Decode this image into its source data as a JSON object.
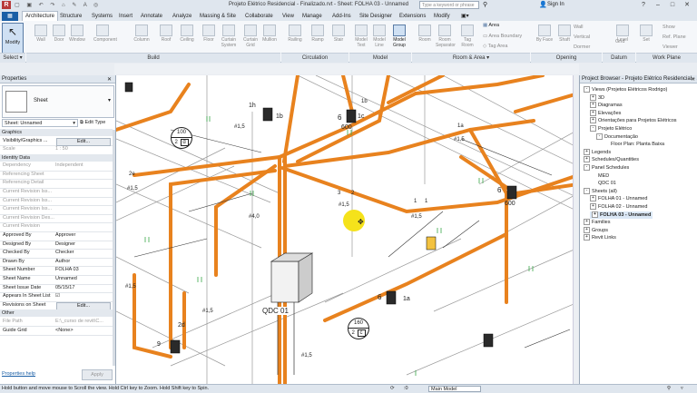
{
  "window": {
    "title": "Projeto Elétrico Residencial - Finalizado.rvt - Sheet: FOLHA 03 - Unnamed",
    "search_placeholder": "Type a keyword or phrase",
    "sign_in": "Sign In"
  },
  "tabs": [
    "Architecture",
    "Structure",
    "Systems",
    "Insert",
    "Annotate",
    "Analyze",
    "Massing & Site",
    "Collaborate",
    "View",
    "Manage",
    "Add-Ins",
    "Site Designer",
    "Extensions",
    "Modify"
  ],
  "ribbon": {
    "buttons": [
      {
        "label": "Modify",
        "on": true
      },
      {
        "label": "Wall",
        "on": false
      },
      {
        "label": "Door",
        "on": false
      },
      {
        "label": "Window",
        "on": false
      },
      {
        "label": "Component",
        "on": false
      },
      {
        "label": "Column",
        "on": false
      },
      {
        "label": "Roof",
        "on": false
      },
      {
        "label": "Ceiling",
        "on": false
      },
      {
        "label": "Floor",
        "on": false
      },
      {
        "label": "Curtain System",
        "on": false
      },
      {
        "label": "Curtain Grid",
        "on": false
      },
      {
        "label": "Mullion",
        "on": false
      },
      {
        "label": "Railing",
        "on": false
      },
      {
        "label": "Ramp",
        "on": false
      },
      {
        "label": "Stair",
        "on": false
      },
      {
        "label": "Model Text",
        "on": false
      },
      {
        "label": "Model Line",
        "on": false
      },
      {
        "label": "Model Group",
        "on": true
      },
      {
        "label": "Room",
        "on": false
      },
      {
        "label": "Room Separator",
        "on": false
      },
      {
        "label": "Tag Room",
        "on": false
      },
      {
        "label": "By Face",
        "on": false
      },
      {
        "label": "Shaft",
        "on": false
      },
      {
        "label": "Level",
        "on": false
      },
      {
        "label": "Set",
        "on": false
      }
    ],
    "side_items": [
      "Area",
      "Area Boundary",
      "Tag Area",
      "Wall",
      "Vertical",
      "Dormer",
      "Grid",
      "Show",
      "Ref. Plane",
      "Viewer"
    ],
    "panels": [
      "Select",
      "Build",
      "Circulation",
      "Model",
      "Room & Area",
      "Opening",
      "Datum",
      "Work Plane"
    ]
  },
  "properties": {
    "header": "Properties",
    "type_name": "Sheet",
    "selector": "Sheet: Unnamed",
    "edit_type": "Edit Type",
    "sections": {
      "graphics": "Graphics",
      "identity": "Identity Data",
      "other": "Other"
    },
    "graphics_rows": [
      {
        "k": "Visibility/Graphics ...",
        "v": "Edit...",
        "button": true
      },
      {
        "k": "Scale",
        "v": "1 : 50",
        "grey": true
      }
    ],
    "identity_rows": [
      {
        "k": "Dependency",
        "v": "Independent",
        "grey": true
      },
      {
        "k": "Referencing Sheet",
        "v": "",
        "grey": true
      },
      {
        "k": "Referencing Detail",
        "v": "",
        "grey": true
      },
      {
        "k": "Current Revision Iss...",
        "v": "",
        "grey": true
      },
      {
        "k": "Current Revision Iss...",
        "v": "",
        "grey": true
      },
      {
        "k": "Current Revision Iss...",
        "v": "",
        "grey": true
      },
      {
        "k": "Current Revision Des...",
        "v": "",
        "grey": true
      },
      {
        "k": "Current Revision",
        "v": "",
        "grey": true
      },
      {
        "k": "Approved By",
        "v": "Approver"
      },
      {
        "k": "Designed By",
        "v": "Designer"
      },
      {
        "k": "Checked By",
        "v": "Checker"
      },
      {
        "k": "Drawn By",
        "v": "Author"
      },
      {
        "k": "Sheet Number",
        "v": "FOLHA 03"
      },
      {
        "k": "Sheet Name",
        "v": "Unnamed"
      },
      {
        "k": "Sheet Issue Date",
        "v": "05/15/17"
      },
      {
        "k": "Appears In Sheet List",
        "v": "☑"
      },
      {
        "k": "Revisions on Sheet",
        "v": "Edit...",
        "button": true
      }
    ],
    "other_rows": [
      {
        "k": "File Path",
        "v": "E:\\_curso de revit\\C...",
        "grey": true
      },
      {
        "k": "Guide Grid",
        "v": "<None>"
      }
    ],
    "help_link": "Properties help",
    "apply": "Apply"
  },
  "canvas": {
    "callouts": [
      {
        "num": "100",
        "sub": "2",
        "letter": "d"
      },
      {
        "num": "160",
        "sub": "2",
        "letter": "c"
      }
    ],
    "panel_label": "QDC 01",
    "labels": [
      "1h",
      "1b",
      "1c",
      "1b",
      "6",
      "600",
      "6",
      "600",
      "2e",
      "1a",
      "2d",
      "3",
      "2",
      "1",
      "1",
      "6",
      "1a",
      "9",
      "#1,5",
      "#1,5",
      "#1,5",
      "#1,5",
      "#4,0",
      "#1,5",
      "#1,5",
      "#1,5",
      "#1,5"
    ]
  },
  "browser": {
    "header": "Project Browser - Projeto Elétrico Residencial - ...",
    "items": [
      {
        "text": "Views (Projetos Elétricos Rodrigo)",
        "indent": 0,
        "tog": "-"
      },
      {
        "text": "3D",
        "indent": 1,
        "tog": "+"
      },
      {
        "text": "Diagramas",
        "indent": 1,
        "tog": "+"
      },
      {
        "text": "Elevações",
        "indent": 1,
        "tog": "+"
      },
      {
        "text": "Orientações para Projetos Elétricos",
        "indent": 1,
        "tog": "+"
      },
      {
        "text": "Projeto Elétrico",
        "indent": 1,
        "tog": "-"
      },
      {
        "text": "Documentação",
        "indent": 2,
        "tog": "-"
      },
      {
        "text": "Floor Plan: Planta Baixa",
        "indent": 3,
        "tog": ""
      },
      {
        "text": "Legends",
        "indent": 0,
        "tog": "+"
      },
      {
        "text": "Schedules/Quantities",
        "indent": 0,
        "tog": "+"
      },
      {
        "text": "Panel Schedules",
        "indent": 0,
        "tog": "-"
      },
      {
        "text": "MED",
        "indent": 1,
        "tog": ""
      },
      {
        "text": "QDC 01",
        "indent": 1,
        "tog": ""
      },
      {
        "text": "Sheets (all)",
        "indent": 0,
        "tog": "-"
      },
      {
        "text": "FOLHA 01 - Unnamed",
        "indent": 1,
        "tog": "+"
      },
      {
        "text": "FOLHA 02 - Unnamed",
        "indent": 1,
        "tog": "+"
      },
      {
        "text": "FOLHA 03 - Unnamed",
        "indent": 1,
        "tog": "+",
        "bold": true
      },
      {
        "text": "Families",
        "indent": 0,
        "tog": "+"
      },
      {
        "text": "Groups",
        "indent": 0,
        "tog": "+"
      },
      {
        "text": "Revit Links",
        "indent": 0,
        "tog": "+"
      }
    ]
  },
  "status": {
    "hint": "Hold button and move mouse to Scroll the view. Hold Ctrl key to Zoom. Hold Shift key to Spin.",
    "view": "Main Model",
    "zoom": ":0"
  }
}
